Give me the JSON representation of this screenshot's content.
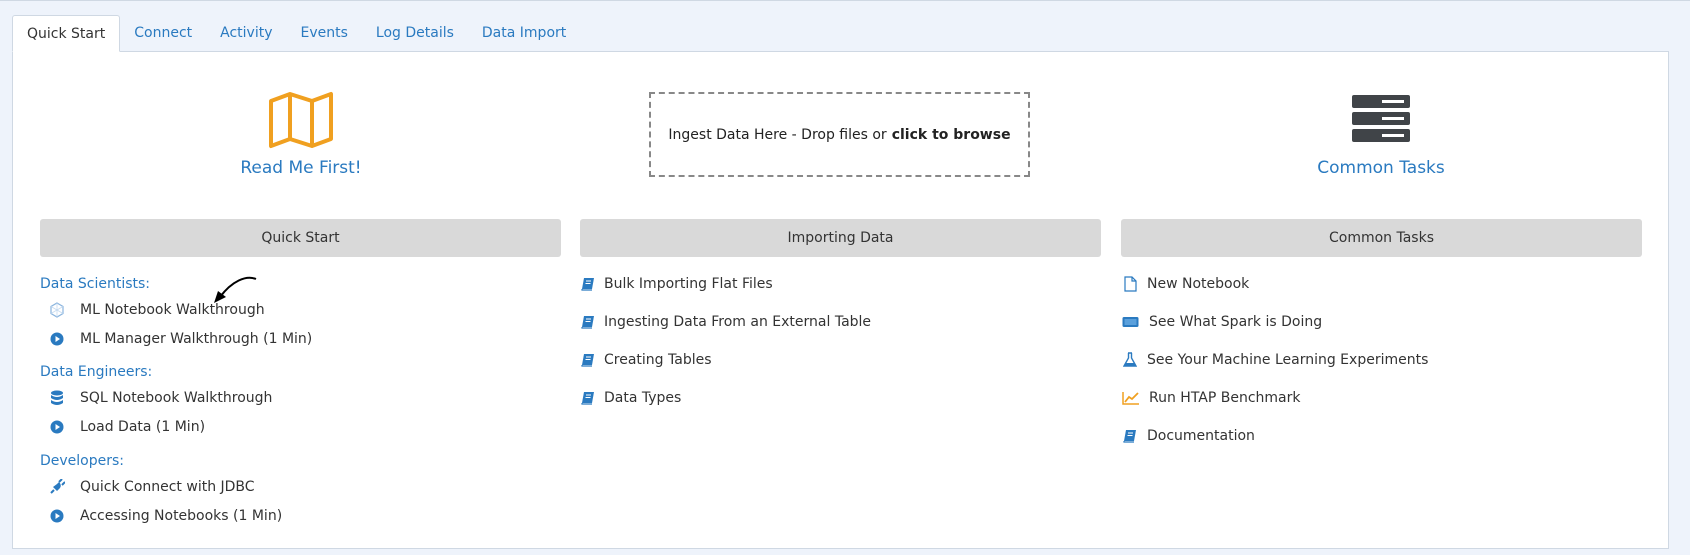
{
  "tabs": [
    "Quick Start",
    "Connect",
    "Activity",
    "Events",
    "Log Details",
    "Data Import"
  ],
  "hero": {
    "readme_label": "Read Me First!",
    "dropzone_text": "Ingest Data Here - Drop files or",
    "dropzone_bold": "click to browse",
    "common_tasks_label": "Common Tasks"
  },
  "sections": {
    "quick_start": "Quick Start",
    "importing_data": "Importing Data",
    "common_tasks": "Common Tasks"
  },
  "quick_start": {
    "data_scientists": "Data Scientists:",
    "ds_items": [
      "ML Notebook Walkthrough",
      "ML Manager Walkthrough (1 Min)"
    ],
    "data_engineers": "Data Engineers:",
    "de_items": [
      "SQL Notebook Walkthrough",
      "Load Data (1 Min)"
    ],
    "developers": "Developers:",
    "dev_items": [
      "Quick Connect with JDBC",
      "Accessing Notebooks (1 Min)"
    ]
  },
  "importing": [
    "Bulk Importing Flat Files",
    "Ingesting Data From an External Table",
    "Creating Tables",
    "Data Types"
  ],
  "common": [
    "New Notebook",
    "See What Spark is Doing",
    "See Your Machine Learning Experiments",
    "Run HTAP Benchmark",
    "Documentation"
  ],
  "colors": {
    "link": "#2a7ac0",
    "accent_orange": "#f0a020",
    "section_bg": "#d9d9d9"
  }
}
